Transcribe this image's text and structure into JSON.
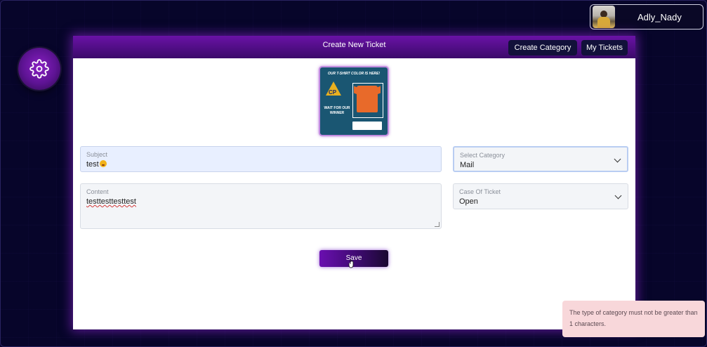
{
  "user": {
    "name": "Adly_Nady"
  },
  "card": {
    "title": "Create New Ticket",
    "create_category_label": "Create Category",
    "my_tickets_label": "My Tickets"
  },
  "ticket_image": {
    "headline": "OUR T-SHIRT COLOR IS HERE!",
    "logo_text": "CP",
    "caption": "WAIT FOR OUR WINNER"
  },
  "form": {
    "subject": {
      "label": "Subject",
      "value": "test"
    },
    "content": {
      "label": "Content",
      "value": "testtesttesttest"
    },
    "category": {
      "label": "Select Category",
      "value": "Mail"
    },
    "case": {
      "label": "Case Of Ticket",
      "value": "Open"
    },
    "save_label": "Save"
  },
  "toast": {
    "message": "The type of category must not be greater than 1 characters."
  },
  "colors": {
    "accent": "#6a12a6",
    "background": "#07052a",
    "toast_bg": "#f8d7da"
  },
  "icons": {
    "settings": "gear-icon",
    "select": "chevron-down-icon"
  }
}
